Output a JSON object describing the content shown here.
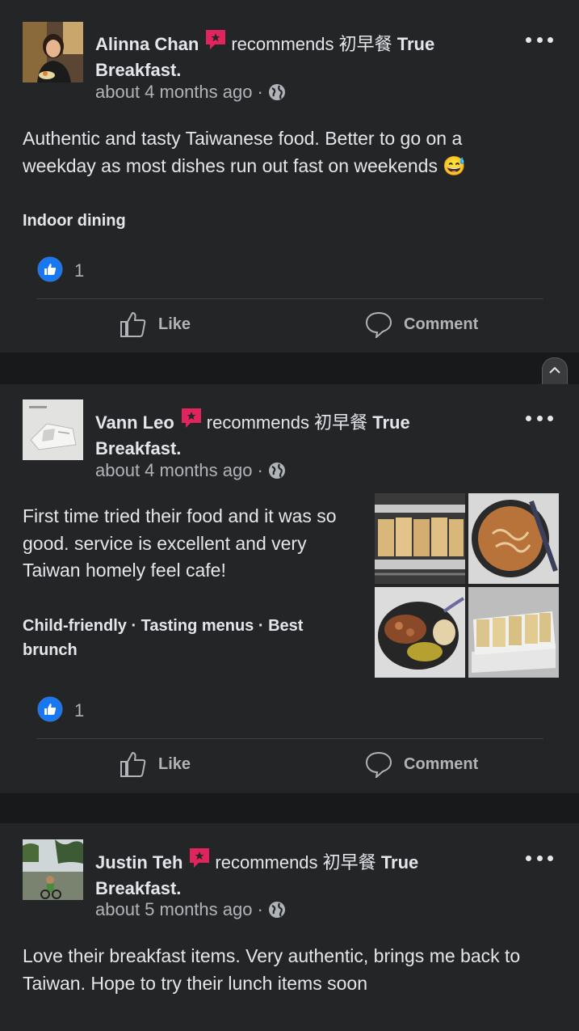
{
  "posts": [
    {
      "author": "Alinna Chan",
      "verb": "recommends",
      "place": "初早餐 True Breakfast",
      "place_cjk": "初早餐",
      "place_en": "True",
      "place_en2": "Breakfast",
      "time": "about 4 months ago",
      "text": "Authentic and tasty Taiwanese food. Better to go on a weekday as most dishes run out fast on weekends 😅",
      "tags": "Indoor dining",
      "likes": "1",
      "like_label": "Like",
      "comment_label": "Comment"
    },
    {
      "author": "Vann Leo",
      "verb": "recommends",
      "place_cjk": "初早餐",
      "place_en": "True",
      "place_en2": "Breakfast",
      "time": "about 4 months ago",
      "text": "First time tried their food and it was so good. service is excellent and very Taiwan homely feel cafe!",
      "tags": "Child-friendly · Tasting menus · Best brunch",
      "likes": "1",
      "like_label": "Like",
      "comment_label": "Comment"
    },
    {
      "author": "Justin Teh",
      "verb": "recommends",
      "place_cjk": "初早餐",
      "place_en": "True",
      "place_en2": "Breakfast",
      "time": "about 5 months ago",
      "text": "Love their breakfast items. Very authentic, brings me back to Taiwan. Hope to try their lunch items soon"
    }
  ],
  "colors": {
    "background": "#18191a",
    "card": "#242526",
    "like_blue": "#1877f2",
    "badge_red": "#e0245e",
    "secondary_text": "#b0b3b8"
  }
}
